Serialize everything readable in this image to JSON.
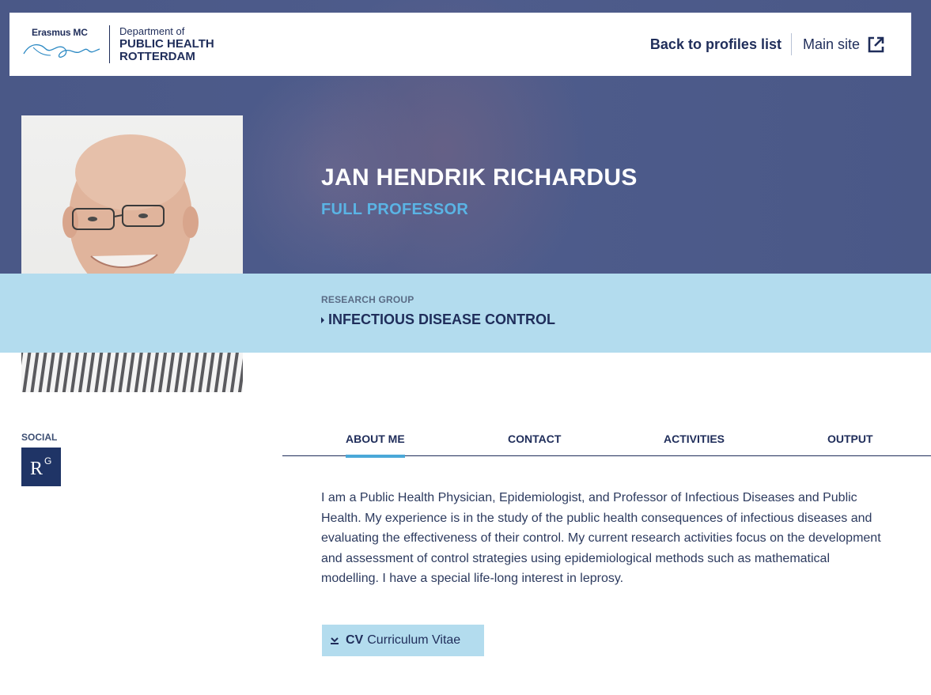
{
  "header": {
    "logo_erasmus": "Erasmus MC",
    "logo_dept_line1": "Department of",
    "logo_dept_line2": "PUBLIC HEALTH",
    "logo_dept_line3": "ROTTERDAM",
    "back_label": "Back to profiles list",
    "main_site_label": "Main site"
  },
  "profile": {
    "name": "JAN HENDRIK RICHARDUS",
    "role": "FULL PROFESSOR",
    "research_group_label": "RESEARCH GROUP",
    "research_group": "INFECTIOUS DISEASE CONTROL"
  },
  "social": {
    "label": "SOCIAL",
    "researchgate_r": "R",
    "researchgate_g": "G"
  },
  "tabs": [
    {
      "label": "ABOUT ME",
      "active": true
    },
    {
      "label": "CONTACT",
      "active": false
    },
    {
      "label": "ACTIVITIES",
      "active": false
    },
    {
      "label": "OUTPUT",
      "active": false
    }
  ],
  "about": {
    "text": "I am a Public Health Physician, Epidemiologist, and Professor of Infectious Diseases and Public Health. My experience is in the study of the public health consequences of infectious diseases and evaluating the effectiveness of their control. My current research activities focus on the development and assessment of control strategies using epidemiological methods such as mathematical modelling. I have a special life-long interest in leprosy."
  },
  "cv_button": {
    "prefix": "CV",
    "label": "Curriculum Vitae"
  },
  "colors": {
    "navy": "#1f2d5a",
    "light_blue": "#b3dcee",
    "accent": "#5ab4e5",
    "hero": "#4e5c8c"
  }
}
